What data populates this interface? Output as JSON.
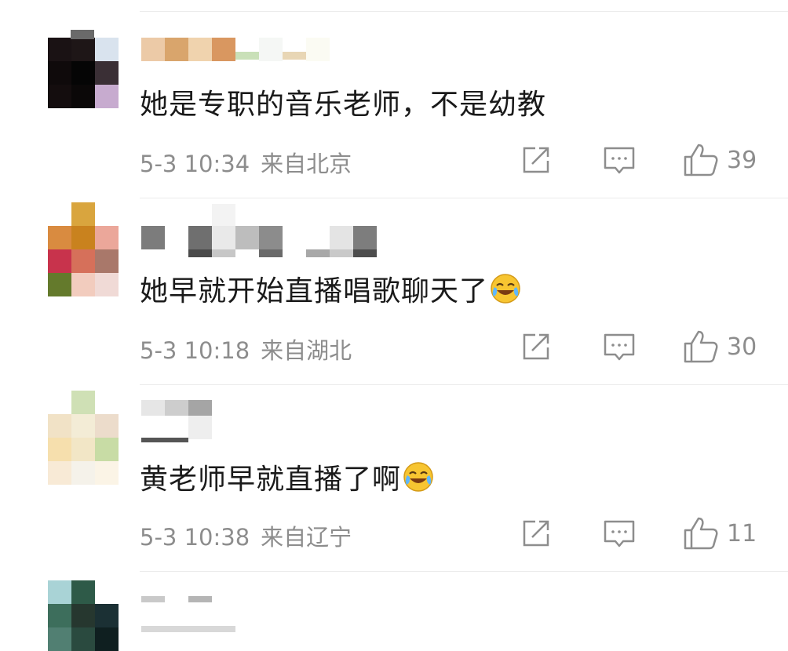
{
  "comments": [
    {
      "text": "她是专职的音乐老师，不是幼教",
      "time": "5-3 10:34",
      "location": "来自北京",
      "likes": "39",
      "has_emoji": false
    },
    {
      "text": "她早就开始直播唱歌聊天了",
      "time": "5-3 10:18",
      "location": "来自湖北",
      "likes": "30",
      "has_emoji": true
    },
    {
      "text": "黄老师早就直播了啊",
      "time": "5-3 10:38",
      "location": "来自辽宁",
      "likes": "11",
      "has_emoji": true
    }
  ],
  "icons": {
    "share": "share-icon",
    "comment": "comment-icon",
    "like": "thumbs-up-icon",
    "emoji": "laugh-cry-emoji"
  },
  "colors": {
    "text": "#1a1a1a",
    "meta": "#8d8d8d",
    "separator": "#ebebeb"
  }
}
